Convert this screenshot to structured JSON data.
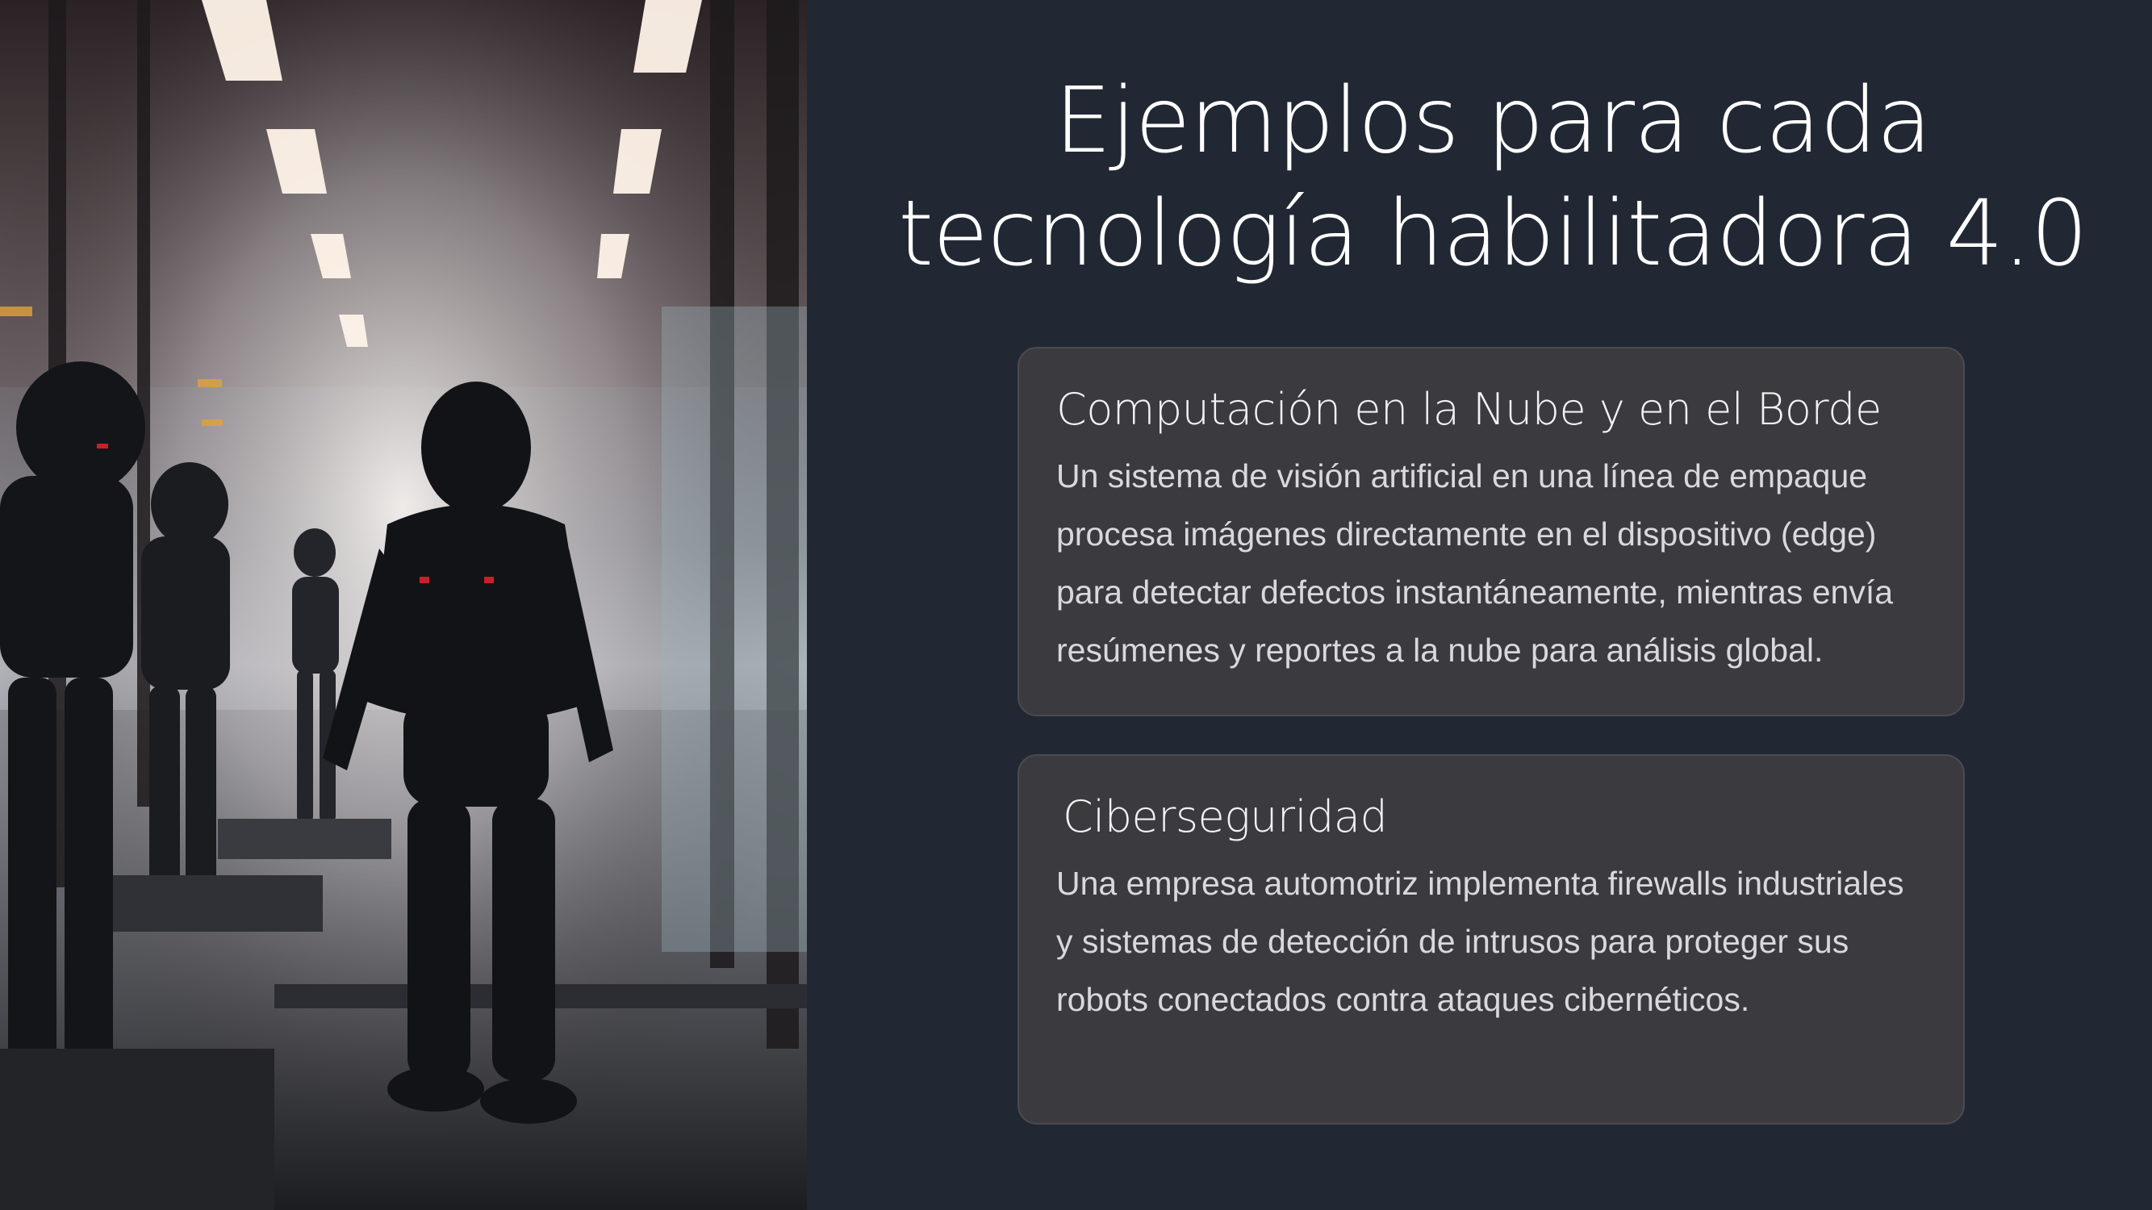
{
  "slide": {
    "title_line1": "Ejemplos para cada",
    "title_line2": "tecnología habilitadora 4.0",
    "background_color": "#222833",
    "card_color": "#3a3a3f"
  },
  "photo": {
    "icon": "robots-in-factory-corridor-illustration"
  },
  "cards": [
    {
      "heading": "Computación en la Nube y en el Borde",
      "body": "Un sistema de visión artificial en una línea de empaque procesa imágenes directamente en el dispositivo (edge) para detectar defectos instantáneamente, mientras envía resúmenes y reportes a la nube para análisis global."
    },
    {
      "heading": "Ciberseguridad",
      "body": "Una empresa automotriz implementa firewalls industriales y sistemas de detección de intrusos para proteger sus robots conectados contra ataques cibernéticos."
    }
  ]
}
